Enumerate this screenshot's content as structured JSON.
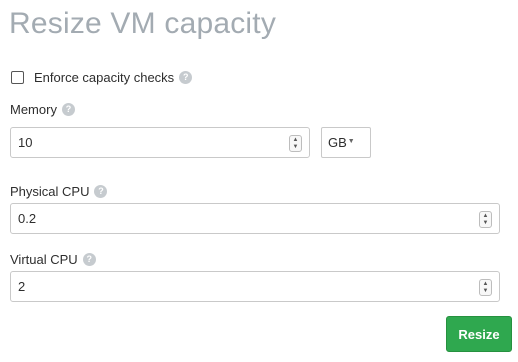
{
  "title": "Resize VM capacity",
  "enforce": {
    "label": "Enforce capacity checks",
    "checked": false
  },
  "memory": {
    "label": "Memory",
    "value": "10",
    "unit": "GB"
  },
  "physical_cpu": {
    "label": "Physical CPU",
    "value": "0.2"
  },
  "virtual_cpu": {
    "label": "Virtual CPU",
    "value": "2"
  },
  "help_glyph": "?",
  "submit": {
    "label": "Resize"
  },
  "colors": {
    "accent": "#2fa84f",
    "title": "#a3abb2"
  }
}
